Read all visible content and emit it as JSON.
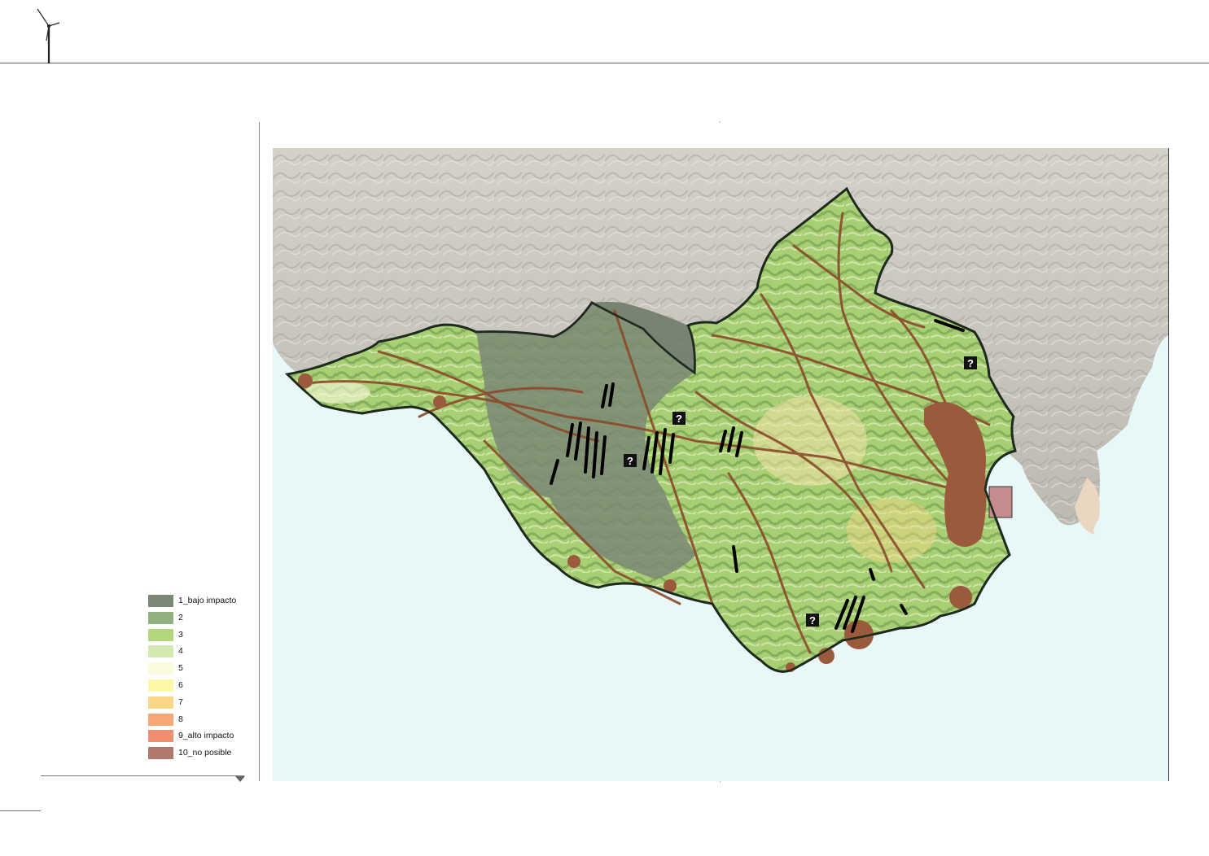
{
  "legend": {
    "items": [
      {
        "label": "1_bajo impacto",
        "color": "#7b8775"
      },
      {
        "label": "2",
        "color": "#93b07f"
      },
      {
        "label": "3",
        "color": "#b3d77a"
      },
      {
        "label": "4",
        "color": "#d3e9b0"
      },
      {
        "label": "5",
        "color": "#fafadc"
      },
      {
        "label": "6",
        "color": "#fbf7a5"
      },
      {
        "label": "7",
        "color": "#f8d789"
      },
      {
        "label": "8",
        "color": "#f6a774"
      },
      {
        "label": "9_alto impacto",
        "color": "#ef8f72"
      },
      {
        "label": "10_no posible",
        "color": "#b0776c"
      }
    ]
  },
  "map": {
    "colors": {
      "sea": "#e8f8f8",
      "terrain": "#c9c6bd",
      "roads": "#8b4a2a",
      "urban": "#9c5a3c",
      "boundary": "#1d2a1d",
      "turbines": "#000000"
    },
    "markers": [
      "?",
      "?",
      "?",
      "?"
    ]
  }
}
